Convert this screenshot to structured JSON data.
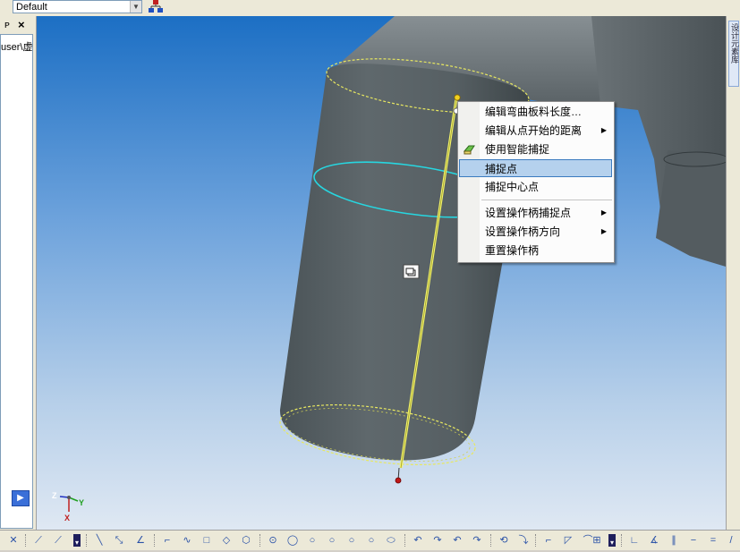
{
  "toolbar": {
    "style_value": "Default"
  },
  "left_panel": {
    "pin_glyph": "ᴘ",
    "close_glyph": "×",
    "path_text": "user\\虚",
    "nav_glyph": "▶"
  },
  "context_menu": {
    "items": [
      {
        "label": "编辑弯曲板料长度…",
        "submenu": false
      },
      {
        "label": "编辑从点开始的距离",
        "submenu": true
      },
      {
        "label": "使用智能捕捉",
        "submenu": false,
        "icon": "smart-snap-icon"
      },
      {
        "label": "捕捉点",
        "submenu": false,
        "selected": true
      },
      {
        "label": "捕捉中心点",
        "submenu": false
      },
      {
        "label": "设置操作柄捕捉点",
        "submenu": true
      },
      {
        "label": "设置操作柄方向",
        "submenu": true
      },
      {
        "label": "重置操作柄",
        "submenu": false
      }
    ],
    "submenu_arrow": "▶"
  },
  "viewport": {
    "axis_labels": {
      "z": "Z",
      "y": "Y",
      "x": "X"
    }
  },
  "right_dock": {
    "tab_label": "设计元素库"
  },
  "colors": {
    "accent": "#3b7bbf",
    "selection": "#b5d1ed",
    "highlight_edge": "#e8e860",
    "handle_ring": "#27d6e0"
  }
}
